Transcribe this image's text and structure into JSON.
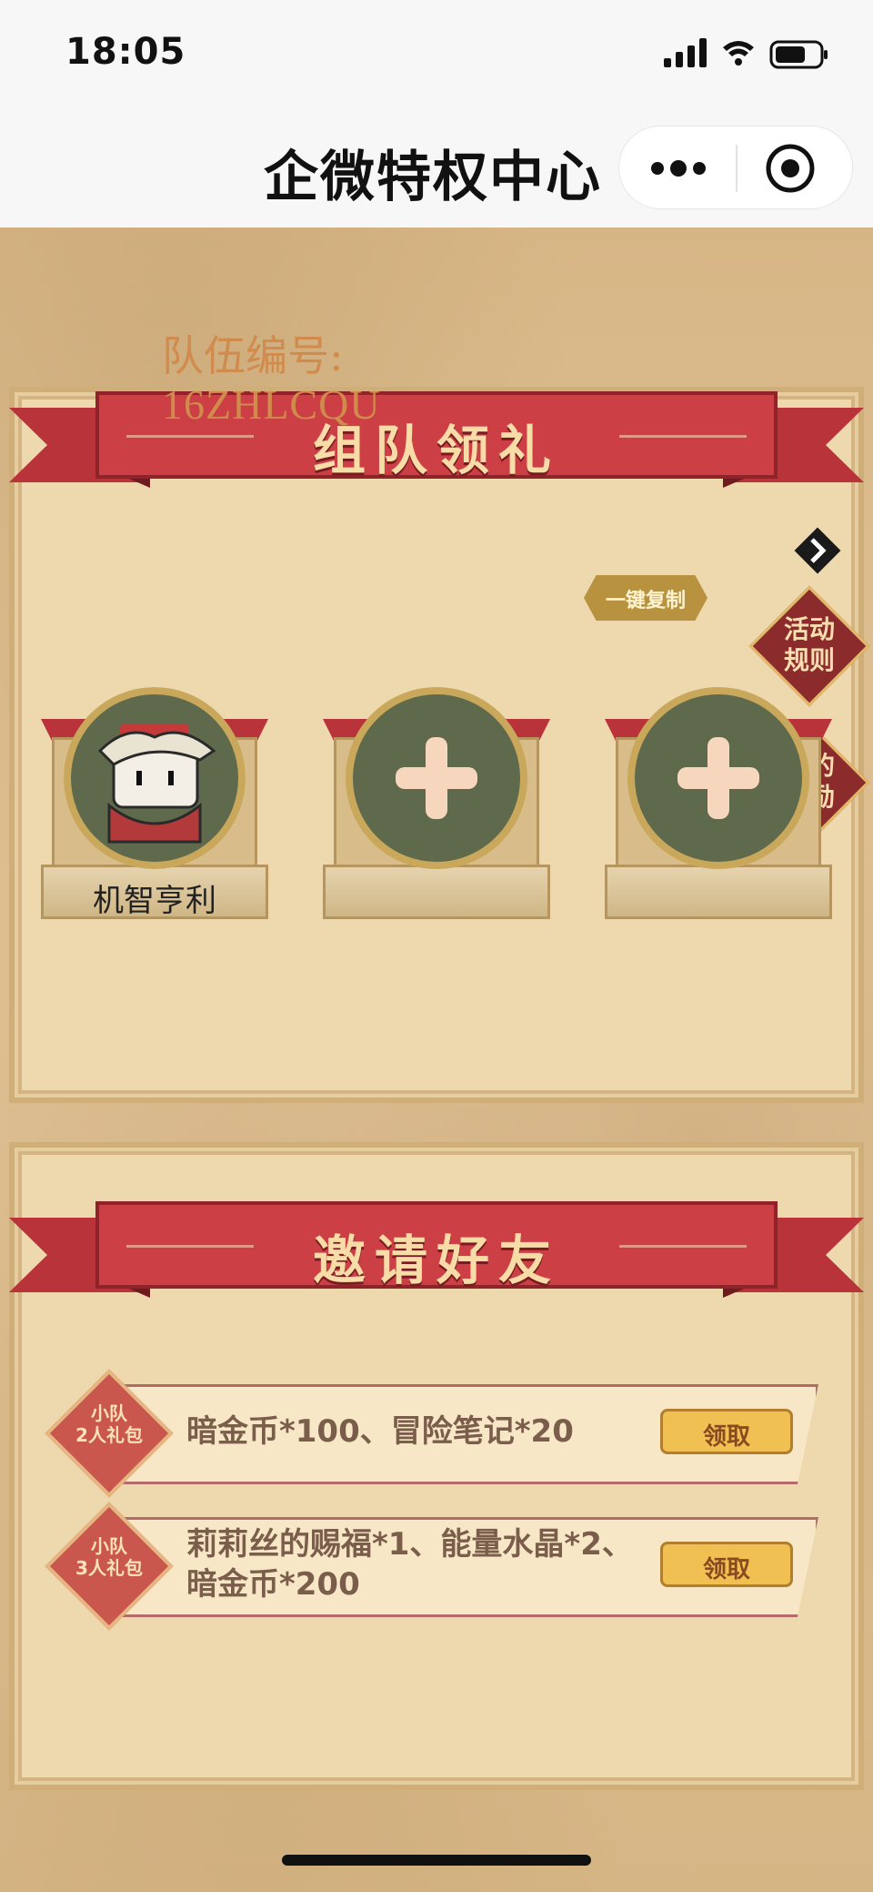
{
  "status": {
    "time": "18:05"
  },
  "nav": {
    "title": "企微特权中心"
  },
  "team": {
    "banner": "组队领礼",
    "label": "队伍编号:",
    "code": "16ZHLCQU",
    "copy_button": "一键复制",
    "side_rules": "活动\n规则",
    "side_rewards": "我的\n奖励",
    "members": [
      {
        "name": "机智亨利"
      }
    ]
  },
  "invite": {
    "banner": "邀请好友",
    "rows": [
      {
        "badge": "小队\n2人礼包",
        "desc": "暗金币*100、冒险笔记*20",
        "claim": "领取"
      },
      {
        "badge": "小队\n3人礼包",
        "desc": "莉莉丝的赐福*1、能量水晶*2、\n暗金币*200",
        "claim": "领取"
      }
    ]
  },
  "colors": {
    "banner_red": "#cb3f45",
    "parchment": "#eed9ae",
    "claim_gold": "#f0c052",
    "slot_green": "#5f6a4c"
  }
}
